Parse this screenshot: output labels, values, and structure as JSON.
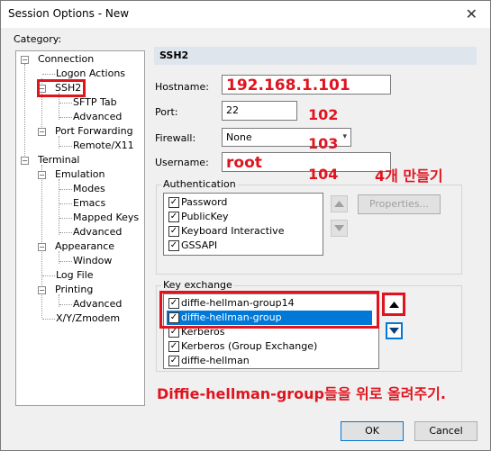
{
  "window": {
    "title": "Session Options - New",
    "close_glyph": "✕"
  },
  "category_label": "Category:",
  "tree": {
    "connection": "Connection",
    "logon_actions": "Logon Actions",
    "ssh2": "SSH2",
    "sftp_tab": "SFTP Tab",
    "advanced_ssh2": "Advanced",
    "port_forwarding": "Port Forwarding",
    "remote_x11": "Remote/X11",
    "terminal": "Terminal",
    "emulation": "Emulation",
    "modes": "Modes",
    "emacs": "Emacs",
    "mapped_keys": "Mapped Keys",
    "advanced_emulation": "Advanced",
    "appearance": "Appearance",
    "window": "Window",
    "log_file": "Log File",
    "printing": "Printing",
    "advanced_printing": "Advanced",
    "xyzmodem": "X/Y/Zmodem"
  },
  "ssh2_panel": {
    "header": "SSH2",
    "hostname_label": "Hostname:",
    "hostname_value": "192.168.1.101",
    "port_label": "Port:",
    "port_value": "22",
    "firewall_label": "Firewall:",
    "firewall_value": "None",
    "username_label": "Username:",
    "username_value": "root",
    "authentication_title": "Authentication",
    "auth_methods": [
      "Password",
      "PublicKey",
      "Keyboard Interactive",
      "GSSAPI"
    ],
    "properties_button": "Properties...",
    "key_exchange_title": "Key exchange",
    "kex_methods": [
      "diffie-hellman-group14",
      "diffie-hellman-group",
      "Kerberos",
      "Kerberos (Group Exchange)",
      "diffie-hellman"
    ]
  },
  "annotations": {
    "port_note": "102",
    "firewall_note": "103",
    "username_note": "104",
    "make_four": "4개 만들기",
    "move_up_note": "Diffie-hellman-group들을 위로 올려주기."
  },
  "buttons": {
    "ok": "OK",
    "cancel": "Cancel"
  },
  "colors": {
    "annotation_red": "#e0141e",
    "selection_blue": "#0078d7",
    "header_bg": "#dfe5ec"
  }
}
